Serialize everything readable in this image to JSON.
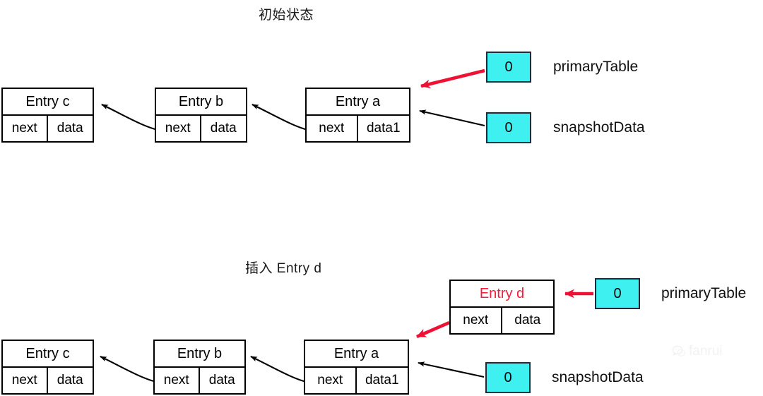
{
  "page": {
    "background": "#ffffff",
    "accent_red": "#ff1a3c",
    "slot_cyan": "#3ef0f0",
    "line_black": "#000000"
  },
  "sections": [
    {
      "id": "initial-state",
      "title": "初始状态",
      "nodes": [
        {
          "id": "entry-c",
          "name": "Entry c",
          "next_label": "next",
          "data_label": "data",
          "highlight": false
        },
        {
          "id": "entry-b",
          "name": "Entry b",
          "next_label": "next",
          "data_label": "data",
          "highlight": false
        },
        {
          "id": "entry-a",
          "name": "Entry a",
          "next_label": "next",
          "data_label": "data1",
          "highlight": false
        }
      ],
      "slots": [
        {
          "id": "primary-table-slot",
          "value": "0",
          "label": "primaryTable",
          "arrow": "red"
        },
        {
          "id": "snapshot-data-slot",
          "value": "0",
          "label": "snapshotData",
          "arrow": "black"
        }
      ]
    },
    {
      "id": "insert-entry-d",
      "title": "插入 Entry d",
      "nodes": [
        {
          "id": "entry-c2",
          "name": "Entry c",
          "next_label": "next",
          "data_label": "data",
          "highlight": false
        },
        {
          "id": "entry-b2",
          "name": "Entry b",
          "next_label": "next",
          "data_label": "data",
          "highlight": false
        },
        {
          "id": "entry-a2",
          "name": "Entry a",
          "next_label": "next",
          "data_label": "data1",
          "highlight": false
        },
        {
          "id": "entry-d",
          "name": "Entry d",
          "next_label": "next",
          "data_label": "data",
          "highlight": true
        }
      ],
      "slots": [
        {
          "id": "primary-table-slot-2",
          "value": "0",
          "label": "primaryTable",
          "arrow": "red"
        },
        {
          "id": "snapshot-data-slot-2",
          "value": "0",
          "label": "snapshotData",
          "arrow": "black"
        }
      ]
    }
  ],
  "watermark": {
    "text": "fanrui"
  }
}
